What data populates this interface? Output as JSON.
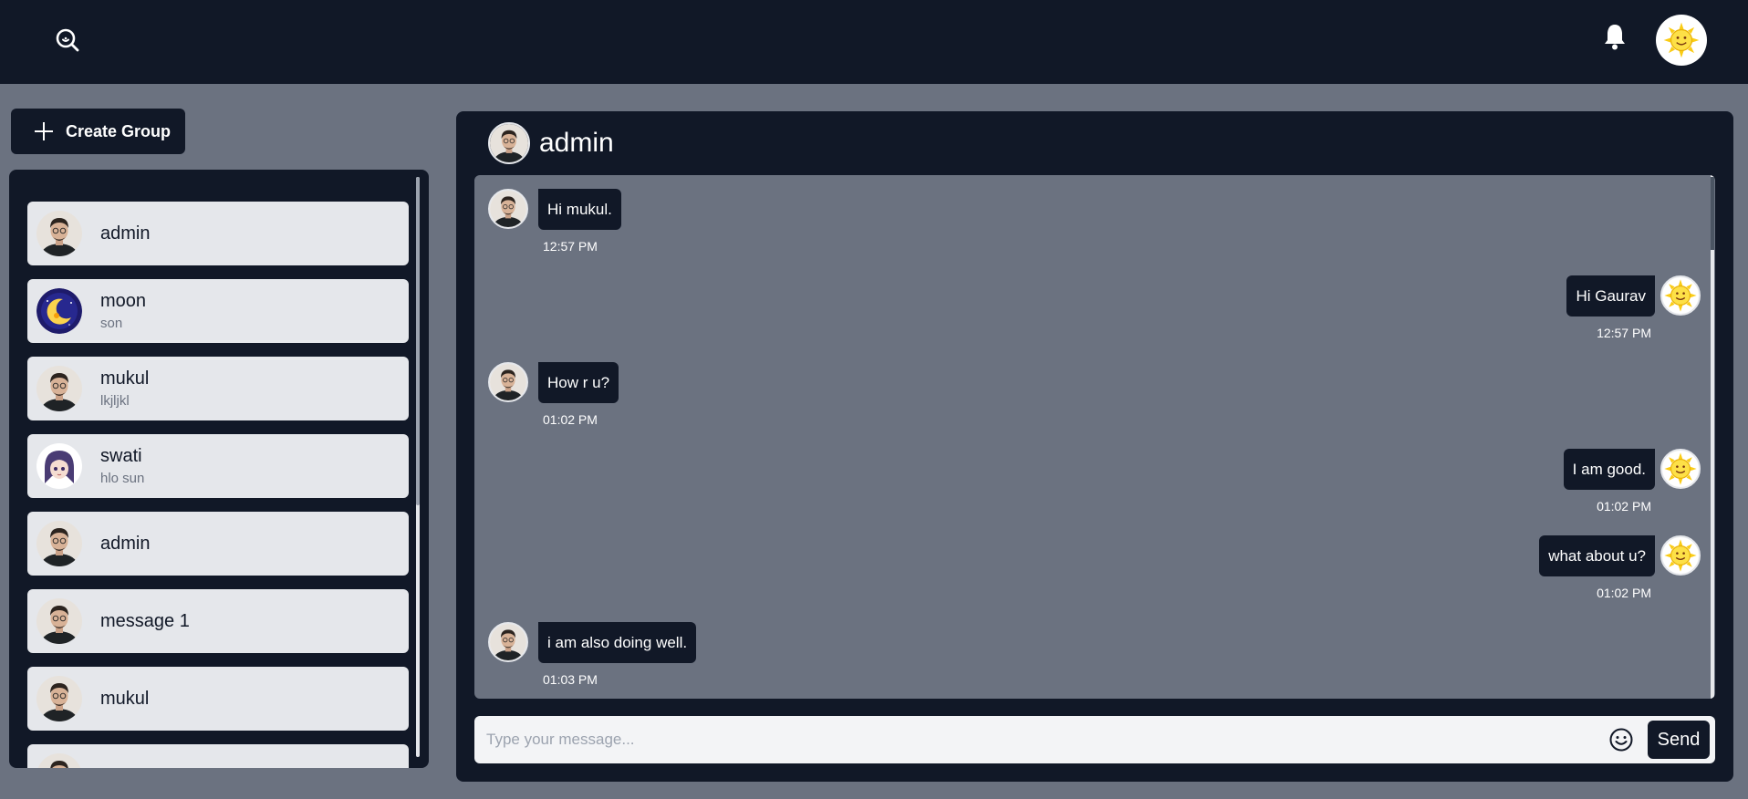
{
  "header": {
    "icons": {
      "search": "search-icon",
      "notifications": "bell-icon",
      "avatar": "sun-avatar"
    }
  },
  "sidebar": {
    "create_group_label": "Create Group",
    "chats": [
      {
        "name": "admin",
        "sub": "",
        "avatar": "man"
      },
      {
        "name": "moon",
        "sub": "son",
        "avatar": "moon"
      },
      {
        "name": "mukul",
        "sub": "lkjljkl",
        "avatar": "man"
      },
      {
        "name": "swati",
        "sub": "hlo sun",
        "avatar": "anime"
      },
      {
        "name": "admin",
        "sub": "",
        "avatar": "man"
      },
      {
        "name": "message 1",
        "sub": "",
        "avatar": "man"
      },
      {
        "name": "mukul",
        "sub": "",
        "avatar": "man"
      },
      {
        "name": "",
        "sub": "",
        "avatar": "man"
      }
    ]
  },
  "chat": {
    "title": "admin",
    "messages": [
      {
        "side": "left",
        "text": "Hi mukul.",
        "time": "12:57 PM"
      },
      {
        "side": "right",
        "text": "Hi Gaurav",
        "time": "12:57 PM"
      },
      {
        "side": "left",
        "text": "How r u?",
        "time": "01:02 PM"
      },
      {
        "side": "right",
        "text": "I am good.",
        "time": "01:02 PM"
      },
      {
        "side": "right",
        "text": "what about u?",
        "time": "01:02 PM"
      },
      {
        "side": "left",
        "text": "i am also doing well.",
        "time": "01:03 PM"
      }
    ],
    "input_placeholder": "Type your message...",
    "send_label": "Send"
  },
  "colors": {
    "navy": "#111827",
    "gray": "#6b7280",
    "light": "#e5e7eb",
    "sun": "#facc15"
  }
}
